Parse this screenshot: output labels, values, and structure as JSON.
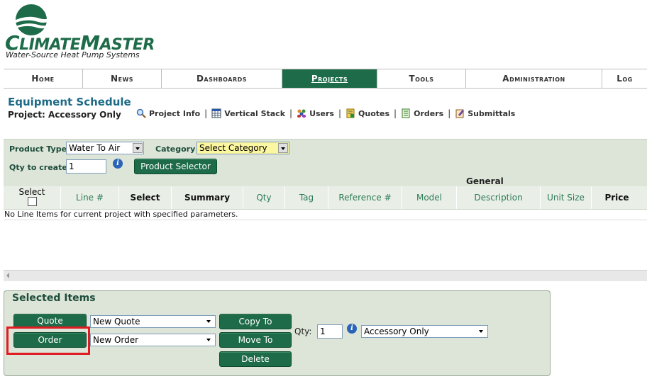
{
  "brand": {
    "name_prefix": "C",
    "name_small1": "LIMATE",
    "name_mid": "M",
    "name_small2": "ASTER",
    "tagline": "Water-Source Heat Pump Systems",
    "color": "#1d6b48"
  },
  "nav": [
    {
      "label": "Home"
    },
    {
      "label": "News"
    },
    {
      "label": "Dashboards"
    },
    {
      "label": "Projects",
      "active": true
    },
    {
      "label": "Tools"
    },
    {
      "label": "Administration"
    },
    {
      "label": "Log"
    }
  ],
  "page": {
    "title": "Equipment Schedule",
    "project_label": "Project: Accessory Only"
  },
  "links": [
    {
      "label": "Project Info",
      "icon": "magnifier-icon"
    },
    {
      "label": "Vertical Stack",
      "icon": "grid-icon"
    },
    {
      "label": "Users",
      "icon": "users-icon"
    },
    {
      "label": "Quotes",
      "icon": "quote-doc-icon"
    },
    {
      "label": "Orders",
      "icon": "orders-doc-icon"
    },
    {
      "label": "Submittals",
      "icon": "submittals-icon"
    }
  ],
  "filter": {
    "product_type_label": "Product Type",
    "product_type_value": "Water To Air",
    "category_label": "Category",
    "category_value": "Select Category",
    "qty_label": "Qty to create",
    "qty_value": "1",
    "product_selector_label": "Product Selector"
  },
  "grid": {
    "group_header": "General",
    "select_header": "Select",
    "columns": [
      "Line #",
      "Select",
      "Summary",
      "Qty",
      "Tag",
      "Reference #",
      "Model",
      "Description",
      "Unit Size",
      "Price"
    ],
    "empty_message": "No Line Items for current project with specified parameters."
  },
  "selected_items": {
    "title": "Selected Items",
    "quote_button": "Quote",
    "order_button": "Order",
    "quote_select": "New Quote",
    "order_select": "New Order",
    "copy_button": "Copy To",
    "move_button": "Move To",
    "delete_button": "Delete",
    "qty_label": "Qty:",
    "qty_value": "1",
    "project_select": "Accessory Only"
  }
}
